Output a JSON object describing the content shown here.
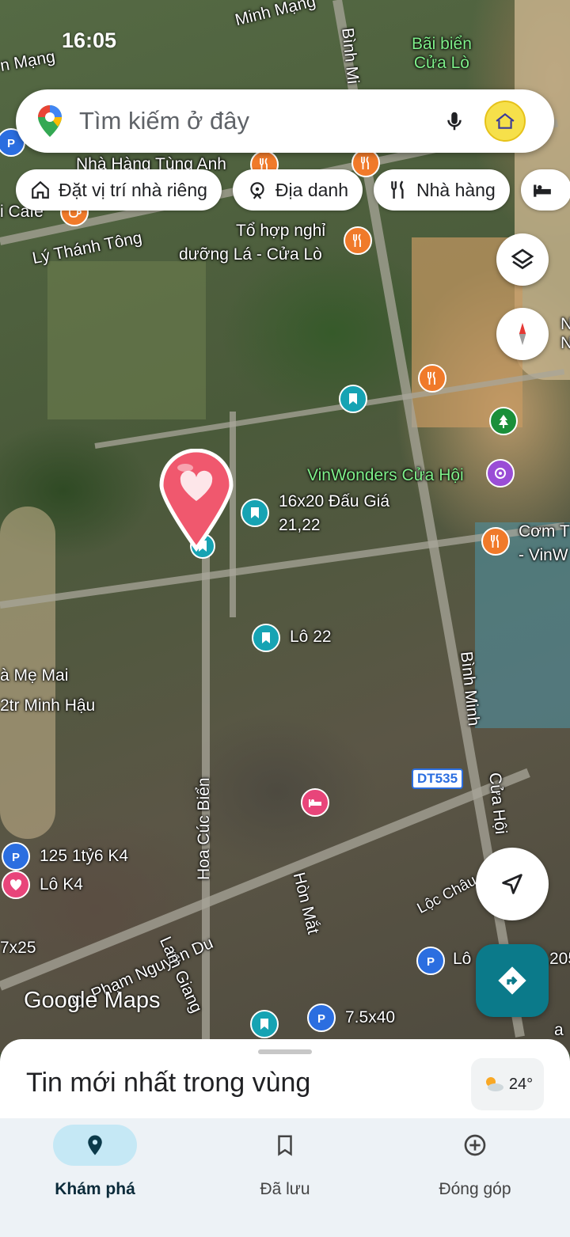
{
  "status_bar": {
    "time": "16:05"
  },
  "search": {
    "placeholder": "Tìm kiếm ở đây"
  },
  "chips": [
    {
      "label": "Đặt vị trí nhà riêng",
      "icon": "home-icon"
    },
    {
      "label": "Địa danh",
      "icon": "landmark-icon"
    },
    {
      "label": "Nhà hàng",
      "icon": "restaurant-icon"
    },
    {
      "label": "",
      "icon": "hotel-icon"
    }
  ],
  "map_labels": {
    "minh_mang_top": "Minh Mạng",
    "minh_mang_left": "n Mạng",
    "binh_minh_top": "Bình Mi",
    "bai_bien": "Bãi biển\nCửa Lò",
    "nha_hang_tung_anh": "Nhà Hàng Tùng Anh",
    "cafe": "i Cafe",
    "ly_thanh_tong": "Lý Thánh Tông",
    "to_hop_nghi_1": "Tổ hợp nghỉ",
    "to_hop_nghi_2": "dưỡng Lá - Cửa Lò",
    "n_right": "N\nN",
    "vinwonders": "VinWonders Cửa Hội",
    "dau_gia_1": "16x20 Đấu Giá",
    "dau_gia_2": "21,22",
    "com_t_1": "Cơm T",
    "com_t_2": "- VinW",
    "lo_22": "Lô 22",
    "me_mai": "à Mẹ Mai",
    "minh_hau": "2tr Minh Hậu",
    "binh_minh_mid": "Bình Minh",
    "dt535": "DT535",
    "cua_hoi": "Cửa Hội",
    "hoa_cuc_bien": "Hoa Cúc Biển",
    "hon_mat": "Hòn Mắt",
    "loc_chau": "Lộc Châu",
    "k4_125": "125 1tỷ6 K4",
    "lo_k4": "Lô K4",
    "x25": "7x25",
    "pham_nguyen_du": "Đ. Phạm Nguyễn Du",
    "lam_giang": "Lam Giang",
    "lo_bottom": "Lô",
    "n205": "205",
    "x40": "7.5x40",
    "a_right": "a"
  },
  "google_maps_logo": "Google Maps",
  "sheet": {
    "title": "Tin mới nhất trong vùng",
    "temperature": "24°"
  },
  "nav": [
    {
      "label": "Khám phá",
      "icon": "location-pin-icon",
      "active": true
    },
    {
      "label": "Đã lưu",
      "icon": "bookmark-icon",
      "active": false
    },
    {
      "label": "Đóng góp",
      "icon": "add-circle-icon",
      "active": false
    }
  ],
  "colors": {
    "teal_pin": "#16a3b3",
    "orange_pin": "#f07a2a",
    "blue_pin": "#2b6ee0",
    "heart_pin": "#f0586e",
    "nav_active": "#c5e8f5",
    "directions": "#0b7a8a"
  }
}
